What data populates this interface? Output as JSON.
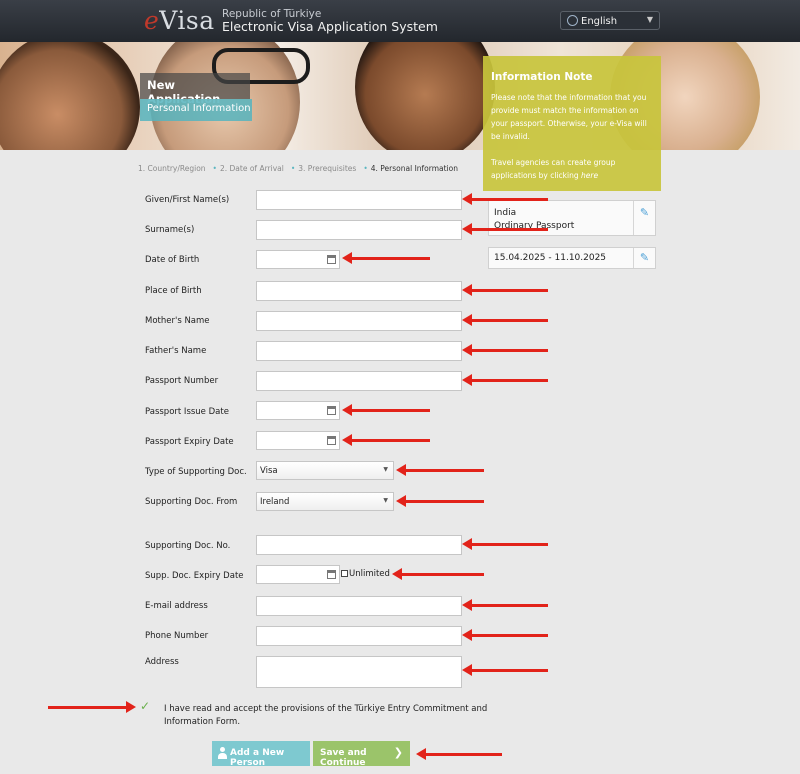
{
  "header": {
    "logo_e": "e",
    "logo_rest": "Visa",
    "republic": "Republic of Türkiye",
    "system_title": "Electronic Visa Application System",
    "language": "English"
  },
  "banner": {
    "new_application": "New Application",
    "personal_information": "Personal Information"
  },
  "info_note": {
    "title": "Information Note",
    "text1": "Please note that the information that you provide must match the information on your passport. Otherwise, your e-Visa will be invalid.",
    "text2_prefix": "Travel agencies can create group applications by clicking ",
    "text2_link": "here"
  },
  "steps": {
    "step1": "1. Country/Region",
    "step2": "2. Date of Arrival",
    "step3": "3. Prerequisites",
    "step4": "4. Personal Information"
  },
  "summary": {
    "country": "India",
    "passport_type": "Ordinary Passport",
    "dates": "15.04.2025 - 11.10.2025"
  },
  "form": {
    "given_name": "Given/First Name(s)",
    "surname": "Surname(s)",
    "dob": "Date of Birth",
    "place_of_birth": "Place of Birth",
    "mother_name": "Mother's Name",
    "father_name": "Father's Name",
    "passport_number": "Passport Number",
    "passport_issue": "Passport Issue Date",
    "passport_expiry": "Passport Expiry Date",
    "doc_type": "Type of Supporting Doc.",
    "doc_type_value": "Visa",
    "doc_from": "Supporting Doc. From",
    "doc_from_value": "Ireland",
    "doc_no": "Supporting Doc. No.",
    "doc_expiry": "Supp. Doc. Expiry Date",
    "unlimited": "Unlimited",
    "email": "E-mail address",
    "phone": "Phone Number",
    "address": "Address"
  },
  "accept_text": "I have read and accept the provisions of the Türkiye Entry Commitment and Information Form.",
  "buttons": {
    "add_person": "Add a New Person",
    "save_continue": "Save and Continue"
  },
  "colors": {
    "header_bg": "#2b3037",
    "note_bg": "#c8c43c",
    "teal": "#7ec9d0",
    "green": "#9bc46a",
    "annotation_arrow": "#e2231a"
  }
}
